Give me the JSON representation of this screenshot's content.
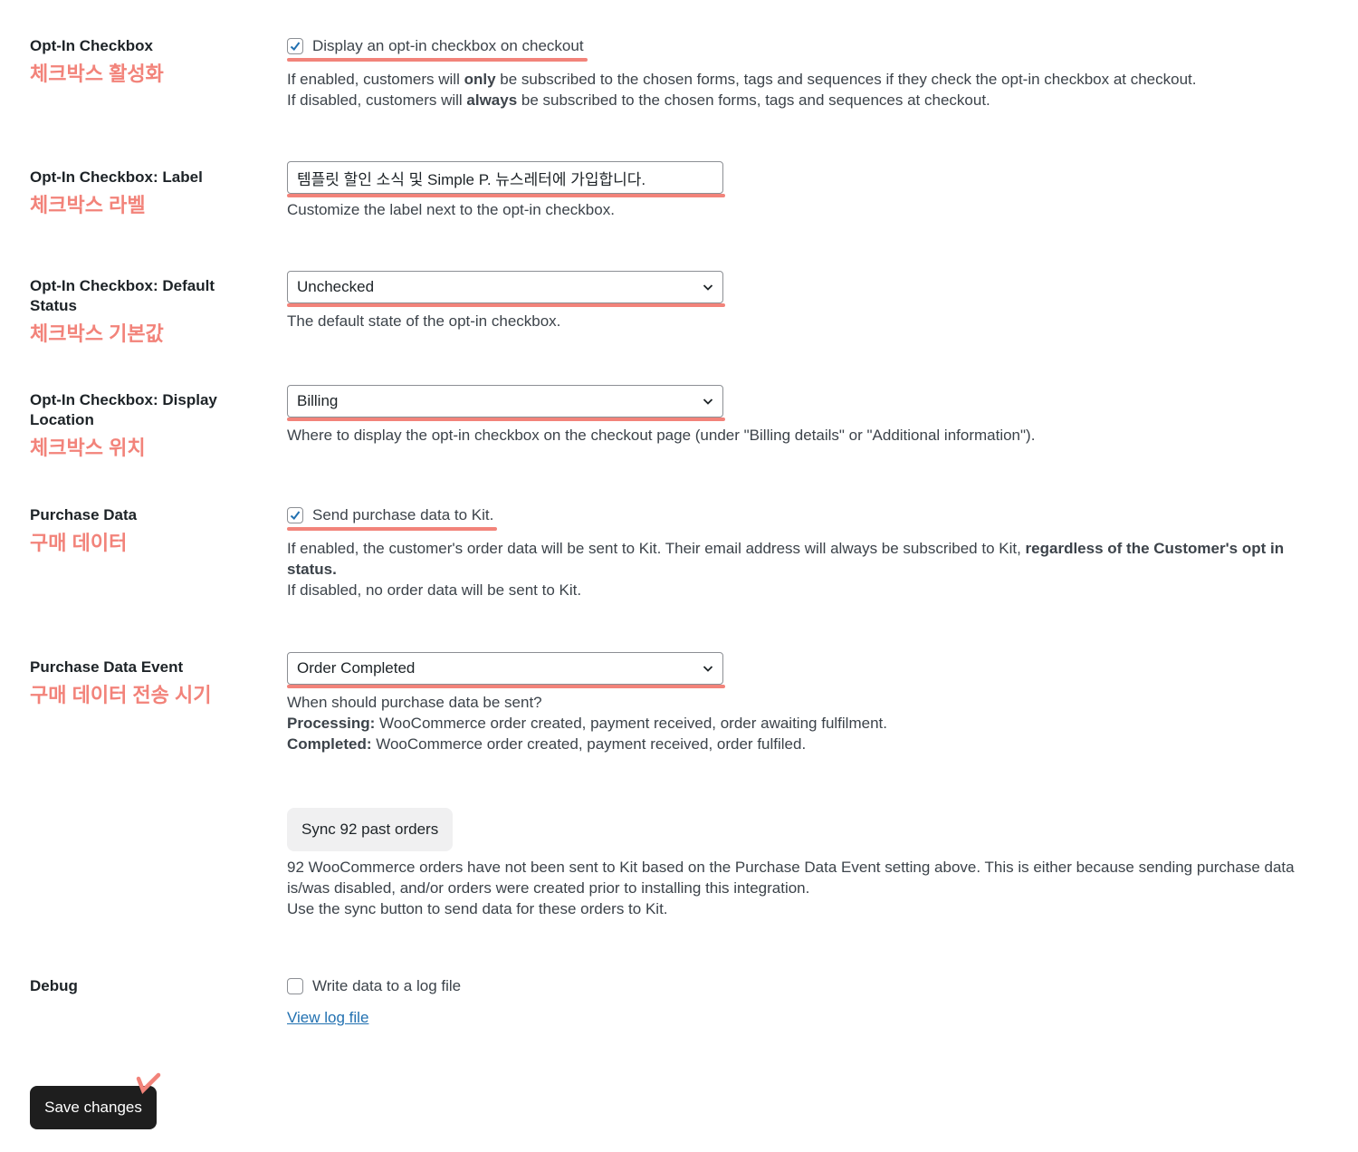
{
  "accent_color": "#f2837a",
  "optin": {
    "label": "Opt-In Checkbox",
    "ko": "체크박스 활성화",
    "checkbox_label": "Display an opt-in checkbox on checkout",
    "checked": true,
    "desc1_a": "If enabled, customers will ",
    "desc1_b": "only",
    "desc1_c": " be subscribed to the chosen forms, tags and sequences if they check the opt-in checkbox at checkout.",
    "desc2_a": "If disabled, customers will ",
    "desc2_b": "always",
    "desc2_c": " be subscribed to the chosen forms, tags and sequences at checkout."
  },
  "optin_label": {
    "label": "Opt-In Checkbox: Label",
    "ko": "체크박스 라벨",
    "value": "템플릿 할인 소식 및 Simple P. 뉴스레터에 가입합니다.",
    "desc": "Customize the label next to the opt-in checkbox."
  },
  "optin_default": {
    "label": "Opt-In Checkbox: Default Status",
    "ko": "체크박스 기본값",
    "value": "Unchecked",
    "desc": "The default state of the opt-in checkbox."
  },
  "optin_location": {
    "label": "Opt-In Checkbox: Display Location",
    "ko": "체크박스 위치",
    "value": "Billing",
    "desc": "Where to display the opt-in checkbox on the checkout page (under \"Billing details\" or \"Additional information\")."
  },
  "purchase_data": {
    "label": "Purchase Data",
    "ko": "구매 데이터",
    "checkbox_label": "Send purchase data to Kit.",
    "checked": true,
    "desc1_a": "If enabled, the customer's order data will be sent to Kit. Their email address will always be subscribed to Kit, ",
    "desc1_b": "regardless of the Customer's opt in status.",
    "desc2": "If disabled, no order data will be sent to Kit."
  },
  "purchase_event": {
    "label": "Purchase Data Event",
    "ko": "구매 데이터 전송 시기",
    "value": "Order Completed",
    "desc1": "When should purchase data be sent?",
    "desc2_b": "Processing:",
    "desc2": " WooCommerce order created, payment received, order awaiting fulfilment.",
    "desc3_b": "Completed:",
    "desc3": " WooCommerce order created, payment received, order fulfiled."
  },
  "sync": {
    "button": "Sync 92 past orders",
    "desc1": "92 WooCommerce orders have not been sent to Kit based on the Purchase Data Event setting above. This is either because sending purchase data is/was disabled, and/or orders were created prior to installing this integration.",
    "desc2": "Use the sync button to send data for these orders to Kit."
  },
  "debug": {
    "label": "Debug",
    "checkbox_label": "Write data to a log file",
    "checked": false,
    "link": "View log file"
  },
  "save_button": "Save changes"
}
